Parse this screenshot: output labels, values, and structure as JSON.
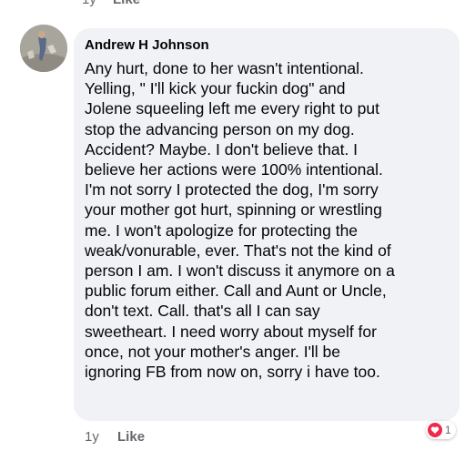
{
  "previous_comment": {
    "time": "1y",
    "like_label": "Like"
  },
  "comment": {
    "author": "Andrew H Johnson",
    "text_lines": [
      "Any hurt,  done to her wasn't intentional.",
      "Yelling, \" I'll kick your fuckin dog\" and",
      "Jolene squeeling left me every right to put",
      "stop the advancing person on my dog.",
      "Accident? Maybe.  I don't believe that. I",
      "believe her actions were 100% intentional.",
      "I'm not sorry I protected the dog, I'm sorry",
      "your mother got hurt, spinning or wrestling",
      "me. I won't apologize for protecting the",
      "weak/vonurable, ever. That's not the kind of",
      "person I am. I won't discuss it anymore on a",
      "public forum either. Call and Aunt or Uncle,",
      "don't text. Call. that's all I can say",
      "sweetheart. I need worry about myself for",
      "once, not your mother's anger. I'll be",
      "ignoring FB from now on,  sorry i have too."
    ],
    "time": "1y",
    "like_label": "Like",
    "reaction": {
      "type": "love",
      "count": "1",
      "color": "#f0284a"
    }
  },
  "colors": {
    "bubble": "#f0f2f5",
    "meta_text": "#65676b",
    "body_text": "#050505"
  }
}
